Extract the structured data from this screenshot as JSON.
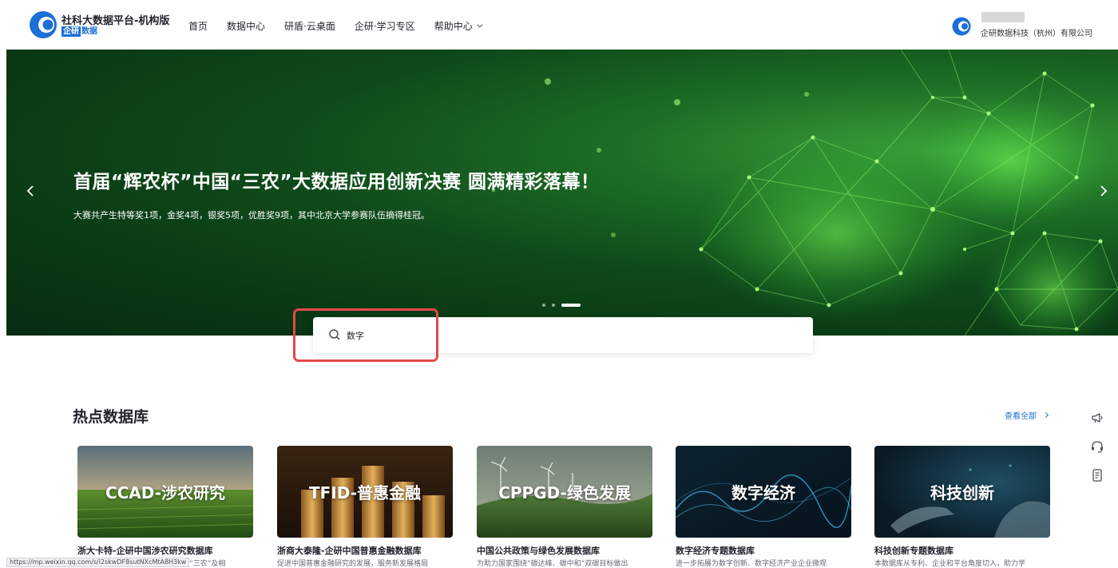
{
  "header": {
    "brand_title": "社科大数据平台-机构版",
    "brand_sub_box": "企研",
    "brand_sub_text": "数据",
    "nav": [
      {
        "label": "首页"
      },
      {
        "label": "数据中心"
      },
      {
        "label": "研盾·云桌面"
      },
      {
        "label": "企研·学习专区"
      },
      {
        "label": "帮助中心"
      }
    ],
    "user_company": "企研数据科技（杭州）有限公司"
  },
  "banner": {
    "title": "首届“辉农杯”中国“三农”大数据应用创新决赛 圆满精彩落幕！",
    "description": "大赛共产生特等奖1项，金奖4项，银奖5项，优胜奖9项，其中北京大学参赛队伍摘得桂冠。",
    "slides_total": 3,
    "active_slide": 3
  },
  "search": {
    "value": "数字",
    "icon": "search-icon"
  },
  "hot": {
    "title": "热点数据库",
    "view_all": "查看全部",
    "cards": [
      {
        "image_label": "CCAD-涉农研究",
        "name": "浙大卡特-企研中国涉农研究数据库",
        "desc": "服务“三农”及相"
      },
      {
        "image_label": "TFID-普惠金融",
        "name": "浙商大泰隆-企研中国普惠金融数据库",
        "desc": "促进中国普惠金融研究的发展，服务新发展格局"
      },
      {
        "image_label": "CPPGD-绿色发展",
        "name": "中国公共政策与绿色发展数据库",
        "desc": "为助力国家围绕“碳达峰、碳中和”双碳目标做出"
      },
      {
        "image_label": "数字经济",
        "name": "数字经济专题数据库",
        "desc": "进一步拓展为数字创新、数字经济产业企业微观"
      },
      {
        "image_label": "科技创新",
        "name": "科技创新专题数据库",
        "desc": "本数据库从专利、企业和平台角度切入，助力学"
      }
    ]
  },
  "side_tools": [
    "megaphone-icon",
    "headset-icon",
    "document-icon"
  ],
  "status_url": "https://mp.weixin.qq.com/s/i2skwDF8sutNXcMtA8H3kw",
  "colors": {
    "accent": "#1b6fd6",
    "highlight": "#e5484d",
    "banner_dark": "#0a3a15",
    "banner_bright": "#3aa23b"
  }
}
